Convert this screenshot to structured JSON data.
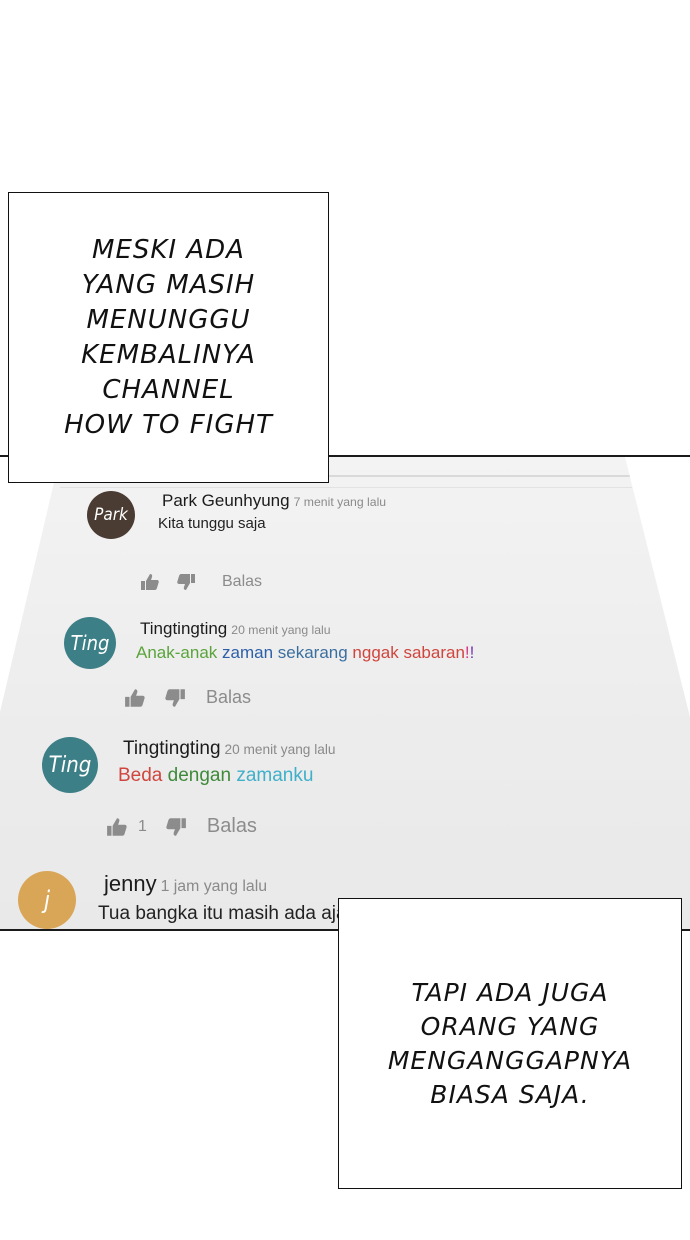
{
  "narration": {
    "top": "MESKI ADA\nYANG MASIH\nMENUNGGU\nKEMBALINYA\nCHANNEL\nHOW TO FIGHT",
    "bottom": "TAPI ADA JUGA\nORANG YANG\nMENGANGGAPNYA\nBIASA SAJA."
  },
  "comments": [
    {
      "avatar": "Park",
      "avatar_color": "#4a3b33",
      "name": "Park Geunhyung",
      "time": "7 menit yang lalu",
      "text": [
        {
          "t": "Kita tunggu saja",
          "c": "#222222"
        }
      ],
      "likes": "",
      "reply": "Balas"
    },
    {
      "avatar": "Ting",
      "avatar_color": "#3d7f87",
      "name": "Tingtingting",
      "time": "20 menit yang lalu",
      "text": [
        {
          "t": "Anak-anak ",
          "c": "#5aa43b"
        },
        {
          "t": "zaman ",
          "c": "#2d5fa8"
        },
        {
          "t": "sekarang ",
          "c": "#3a6fa0"
        },
        {
          "t": "nggak ",
          "c": "#d0453d"
        },
        {
          "t": "sabaran",
          "c": "#d0453d"
        },
        {
          "t": "!",
          "c": "#d63a8a"
        },
        {
          "t": "!",
          "c": "#7a3bb5"
        }
      ],
      "likes": "",
      "reply": "Balas"
    },
    {
      "avatar": "Ting",
      "avatar_color": "#3d7f87",
      "name": "Tingtingting",
      "time": "20 menit yang lalu",
      "text": [
        {
          "t": "Beda ",
          "c": "#d0453d"
        },
        {
          "t": "dengan ",
          "c": "#3f8a3a"
        },
        {
          "t": "zamanku",
          "c": "#3fb0c9"
        }
      ],
      "likes": "1",
      "reply": "Balas"
    },
    {
      "avatar": "j",
      "avatar_color": "#d9a657",
      "name": "jenny",
      "time": "1 jam yang lalu",
      "text": [
        {
          "t": "Tua bangka itu masih ada aja",
          "c": "#222222"
        }
      ],
      "likes": "",
      "reply": ""
    }
  ]
}
